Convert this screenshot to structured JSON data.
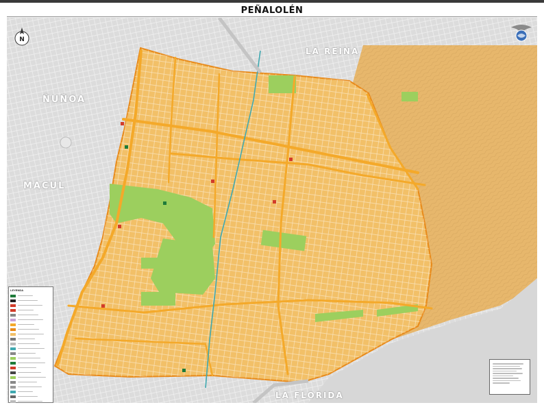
{
  "title": "PEÑALOLÉN",
  "districts": [
    {
      "id": "la-reina",
      "label": "LA REINA"
    },
    {
      "id": "nunoa",
      "label": "ÑUÑOA"
    },
    {
      "id": "macul",
      "label": "MACUL"
    },
    {
      "id": "la-florida",
      "label": "LA FLORIDA"
    }
  ],
  "compass": {
    "letter": "N"
  },
  "legend": {
    "title": "LEYENDA",
    "item_count": 26
  },
  "colors": {
    "urban_area": "#f2c068",
    "foothills": "#e7b76c",
    "main_road": "#f4a92a",
    "parks": "#9ccf5e",
    "surroundings": "#dcdcdc",
    "water": "#3fa8b0",
    "boundary": "#e88a1a"
  },
  "icons": [
    "north-arrow-icon",
    "municipal-crest-icon"
  ]
}
